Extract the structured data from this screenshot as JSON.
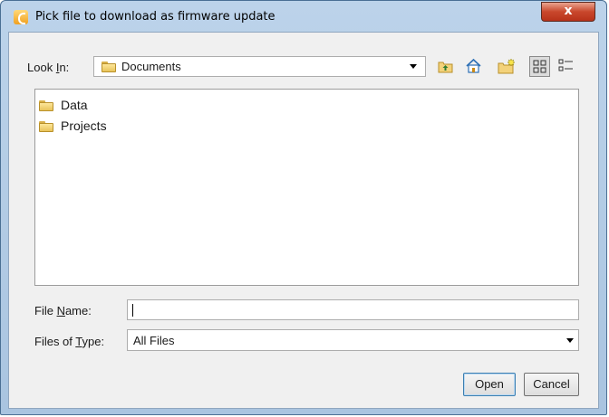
{
  "window": {
    "title": "Pick file to download as firmware update",
    "close_label": "x"
  },
  "lookin": {
    "label_pre": "Look ",
    "label_mnemonic": "I",
    "label_post": "n:",
    "value": "Documents"
  },
  "toolbar": {
    "icons": [
      "up-one-level-icon",
      "home-icon",
      "new-folder-icon",
      "list-view-icon",
      "details-view-icon"
    ]
  },
  "files": [
    {
      "name": "Data",
      "type": "folder"
    },
    {
      "name": "Projects",
      "type": "folder"
    }
  ],
  "filename": {
    "label_pre": "File ",
    "label_mnemonic": "N",
    "label_post": "ame:",
    "value": ""
  },
  "filetype": {
    "label_pre": "Files of ",
    "label_mnemonic": "T",
    "label_post": "ype:",
    "value": "All Files"
  },
  "buttons": {
    "open": "Open",
    "cancel": "Cancel"
  },
  "colors": {
    "title_bar": "#bcd3ea",
    "close_button": "#c9472c",
    "dialog_bg": "#f0f0f0",
    "folder": "#e8c45a"
  }
}
